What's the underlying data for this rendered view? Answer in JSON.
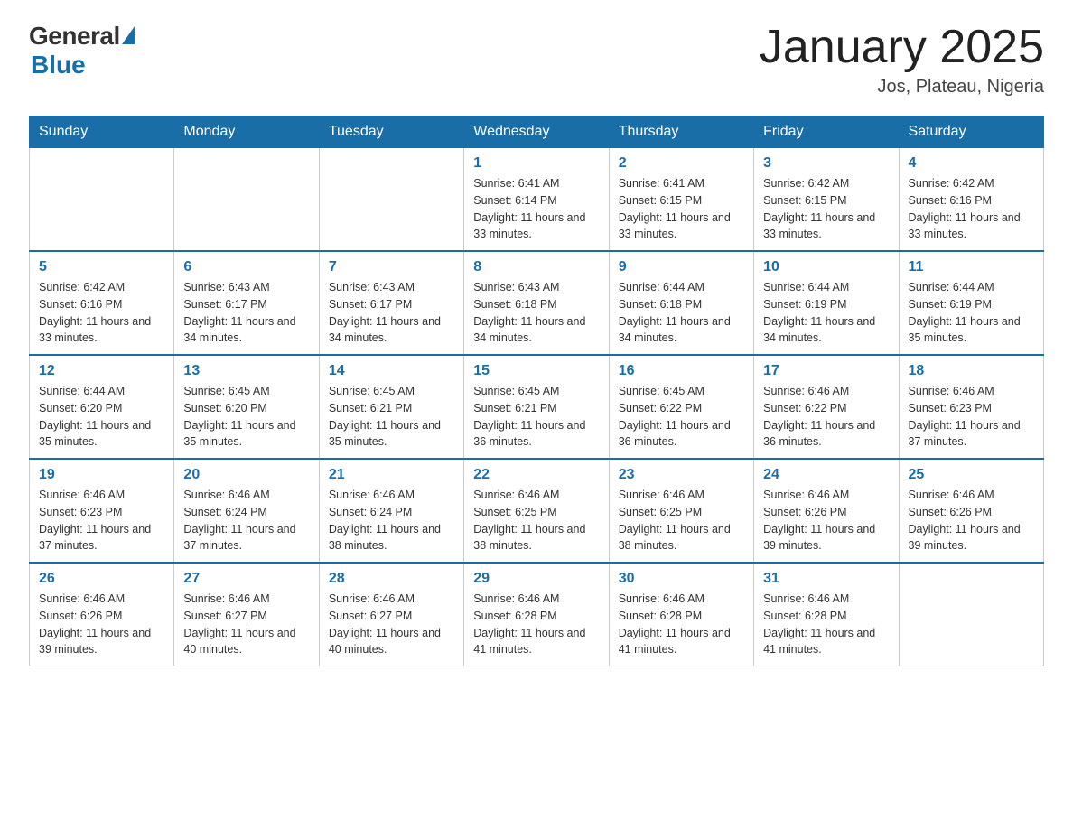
{
  "header": {
    "logo_general": "General",
    "logo_blue": "Blue",
    "title": "January 2025",
    "subtitle": "Jos, Plateau, Nigeria"
  },
  "days_of_week": [
    "Sunday",
    "Monday",
    "Tuesday",
    "Wednesday",
    "Thursday",
    "Friday",
    "Saturday"
  ],
  "weeks": [
    [
      {
        "day": "",
        "info": ""
      },
      {
        "day": "",
        "info": ""
      },
      {
        "day": "",
        "info": ""
      },
      {
        "day": "1",
        "info": "Sunrise: 6:41 AM\nSunset: 6:14 PM\nDaylight: 11 hours and 33 minutes."
      },
      {
        "day": "2",
        "info": "Sunrise: 6:41 AM\nSunset: 6:15 PM\nDaylight: 11 hours and 33 minutes."
      },
      {
        "day": "3",
        "info": "Sunrise: 6:42 AM\nSunset: 6:15 PM\nDaylight: 11 hours and 33 minutes."
      },
      {
        "day": "4",
        "info": "Sunrise: 6:42 AM\nSunset: 6:16 PM\nDaylight: 11 hours and 33 minutes."
      }
    ],
    [
      {
        "day": "5",
        "info": "Sunrise: 6:42 AM\nSunset: 6:16 PM\nDaylight: 11 hours and 33 minutes."
      },
      {
        "day": "6",
        "info": "Sunrise: 6:43 AM\nSunset: 6:17 PM\nDaylight: 11 hours and 34 minutes."
      },
      {
        "day": "7",
        "info": "Sunrise: 6:43 AM\nSunset: 6:17 PM\nDaylight: 11 hours and 34 minutes."
      },
      {
        "day": "8",
        "info": "Sunrise: 6:43 AM\nSunset: 6:18 PM\nDaylight: 11 hours and 34 minutes."
      },
      {
        "day": "9",
        "info": "Sunrise: 6:44 AM\nSunset: 6:18 PM\nDaylight: 11 hours and 34 minutes."
      },
      {
        "day": "10",
        "info": "Sunrise: 6:44 AM\nSunset: 6:19 PM\nDaylight: 11 hours and 34 minutes."
      },
      {
        "day": "11",
        "info": "Sunrise: 6:44 AM\nSunset: 6:19 PM\nDaylight: 11 hours and 35 minutes."
      }
    ],
    [
      {
        "day": "12",
        "info": "Sunrise: 6:44 AM\nSunset: 6:20 PM\nDaylight: 11 hours and 35 minutes."
      },
      {
        "day": "13",
        "info": "Sunrise: 6:45 AM\nSunset: 6:20 PM\nDaylight: 11 hours and 35 minutes."
      },
      {
        "day": "14",
        "info": "Sunrise: 6:45 AM\nSunset: 6:21 PM\nDaylight: 11 hours and 35 minutes."
      },
      {
        "day": "15",
        "info": "Sunrise: 6:45 AM\nSunset: 6:21 PM\nDaylight: 11 hours and 36 minutes."
      },
      {
        "day": "16",
        "info": "Sunrise: 6:45 AM\nSunset: 6:22 PM\nDaylight: 11 hours and 36 minutes."
      },
      {
        "day": "17",
        "info": "Sunrise: 6:46 AM\nSunset: 6:22 PM\nDaylight: 11 hours and 36 minutes."
      },
      {
        "day": "18",
        "info": "Sunrise: 6:46 AM\nSunset: 6:23 PM\nDaylight: 11 hours and 37 minutes."
      }
    ],
    [
      {
        "day": "19",
        "info": "Sunrise: 6:46 AM\nSunset: 6:23 PM\nDaylight: 11 hours and 37 minutes."
      },
      {
        "day": "20",
        "info": "Sunrise: 6:46 AM\nSunset: 6:24 PM\nDaylight: 11 hours and 37 minutes."
      },
      {
        "day": "21",
        "info": "Sunrise: 6:46 AM\nSunset: 6:24 PM\nDaylight: 11 hours and 38 minutes."
      },
      {
        "day": "22",
        "info": "Sunrise: 6:46 AM\nSunset: 6:25 PM\nDaylight: 11 hours and 38 minutes."
      },
      {
        "day": "23",
        "info": "Sunrise: 6:46 AM\nSunset: 6:25 PM\nDaylight: 11 hours and 38 minutes."
      },
      {
        "day": "24",
        "info": "Sunrise: 6:46 AM\nSunset: 6:26 PM\nDaylight: 11 hours and 39 minutes."
      },
      {
        "day": "25",
        "info": "Sunrise: 6:46 AM\nSunset: 6:26 PM\nDaylight: 11 hours and 39 minutes."
      }
    ],
    [
      {
        "day": "26",
        "info": "Sunrise: 6:46 AM\nSunset: 6:26 PM\nDaylight: 11 hours and 39 minutes."
      },
      {
        "day": "27",
        "info": "Sunrise: 6:46 AM\nSunset: 6:27 PM\nDaylight: 11 hours and 40 minutes."
      },
      {
        "day": "28",
        "info": "Sunrise: 6:46 AM\nSunset: 6:27 PM\nDaylight: 11 hours and 40 minutes."
      },
      {
        "day": "29",
        "info": "Sunrise: 6:46 AM\nSunset: 6:28 PM\nDaylight: 11 hours and 41 minutes."
      },
      {
        "day": "30",
        "info": "Sunrise: 6:46 AM\nSunset: 6:28 PM\nDaylight: 11 hours and 41 minutes."
      },
      {
        "day": "31",
        "info": "Sunrise: 6:46 AM\nSunset: 6:28 PM\nDaylight: 11 hours and 41 minutes."
      },
      {
        "day": "",
        "info": ""
      }
    ]
  ]
}
